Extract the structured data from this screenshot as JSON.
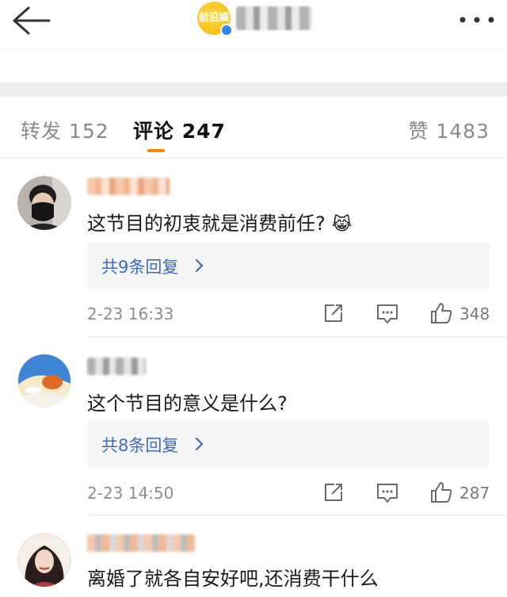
{
  "tabs": {
    "repost": "转发 152",
    "comments": "评论 247",
    "likes": "赞 1483"
  },
  "header": {
    "brand_logo_text": "前沿娱"
  },
  "comments": [
    {
      "text": "这节目的初衷就是消费前任?",
      "emoji": "😹",
      "replies": "共9条回复",
      "time": "2-23 16:33",
      "likes": "348"
    },
    {
      "text": "这个节目的意义是什么?",
      "replies": "共8条回复",
      "time": "2-23 14:50",
      "likes": "287"
    },
    {
      "text": "离婚了就各自安好吧,还消费干什么"
    }
  ]
}
